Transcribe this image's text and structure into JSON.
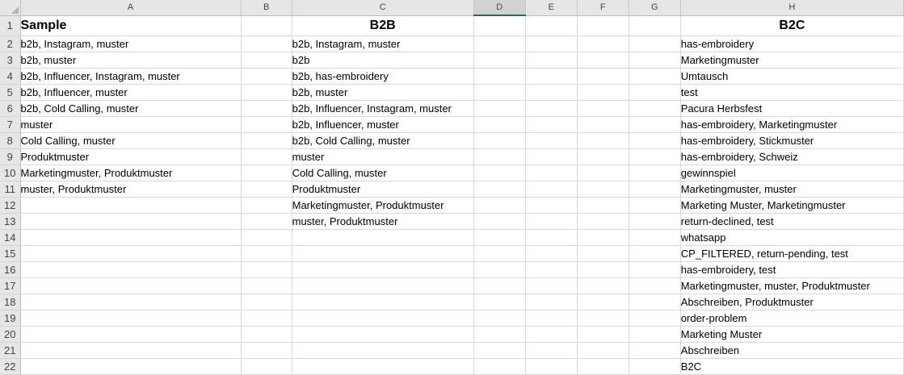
{
  "columns": [
    "A",
    "B",
    "C",
    "D",
    "E",
    "F",
    "G",
    "H"
  ],
  "active_column": "D",
  "rows": [
    {
      "num": "1",
      "A": "Sample",
      "C": "B2B",
      "H": "B2C"
    },
    {
      "num": "2",
      "A": "b2b, Instagram, muster",
      "C": "b2b, Instagram, muster",
      "H": "has-embroidery"
    },
    {
      "num": "3",
      "A": "b2b, muster",
      "C": "b2b",
      "H": "Marketingmuster"
    },
    {
      "num": "4",
      "A": "b2b, Influencer, Instagram, muster",
      "C": "b2b, has-embroidery",
      "H": "Umtausch"
    },
    {
      "num": "5",
      "A": "b2b, Influencer, muster",
      "C": "b2b, muster",
      "H": "test"
    },
    {
      "num": "6",
      "A": "b2b, Cold Calling, muster",
      "C": "b2b, Influencer, Instagram, muster",
      "H": "Pacura Herbsfest"
    },
    {
      "num": "7",
      "A": "muster",
      "C": "b2b, Influencer, muster",
      "H": "has-embroidery, Marketingmuster"
    },
    {
      "num": "8",
      "A": "Cold Calling, muster",
      "C": "b2b, Cold Calling, muster",
      "H": "has-embroidery, Stickmuster"
    },
    {
      "num": "9",
      "A": "Produktmuster",
      "C": "muster",
      "H": "has-embroidery, Schweiz"
    },
    {
      "num": "10",
      "A": "Marketingmuster, Produktmuster",
      "C": "Cold Calling, muster",
      "H": "gewinnspiel"
    },
    {
      "num": "11",
      "A": "muster, Produktmuster",
      "C": "Produktmuster",
      "H": "Marketingmuster, muster"
    },
    {
      "num": "12",
      "A": "",
      "C": "Marketingmuster, Produktmuster",
      "H": "Marketing Muster, Marketingmuster"
    },
    {
      "num": "13",
      "A": "",
      "C": "muster, Produktmuster",
      "H": "return-declined, test"
    },
    {
      "num": "14",
      "A": "",
      "C": "",
      "H": "whatsapp"
    },
    {
      "num": "15",
      "A": "",
      "C": "",
      "H": "CP_FILTERED, return-pending, test"
    },
    {
      "num": "16",
      "A": "",
      "C": "",
      "H": "has-embroidery, test"
    },
    {
      "num": "17",
      "A": "",
      "C": "",
      "H": "Marketingmuster, muster, Produktmuster"
    },
    {
      "num": "18",
      "A": "",
      "C": "",
      "H": "Abschreiben, Produktmuster"
    },
    {
      "num": "19",
      "A": "",
      "C": "",
      "H": "order-problem"
    },
    {
      "num": "20",
      "A": "",
      "C": "",
      "H": "Marketing Muster"
    },
    {
      "num": "21",
      "A": "",
      "C": "",
      "H": "Abschreiben"
    },
    {
      "num": "22",
      "A": "",
      "C": "",
      "H": "B2C"
    }
  ]
}
